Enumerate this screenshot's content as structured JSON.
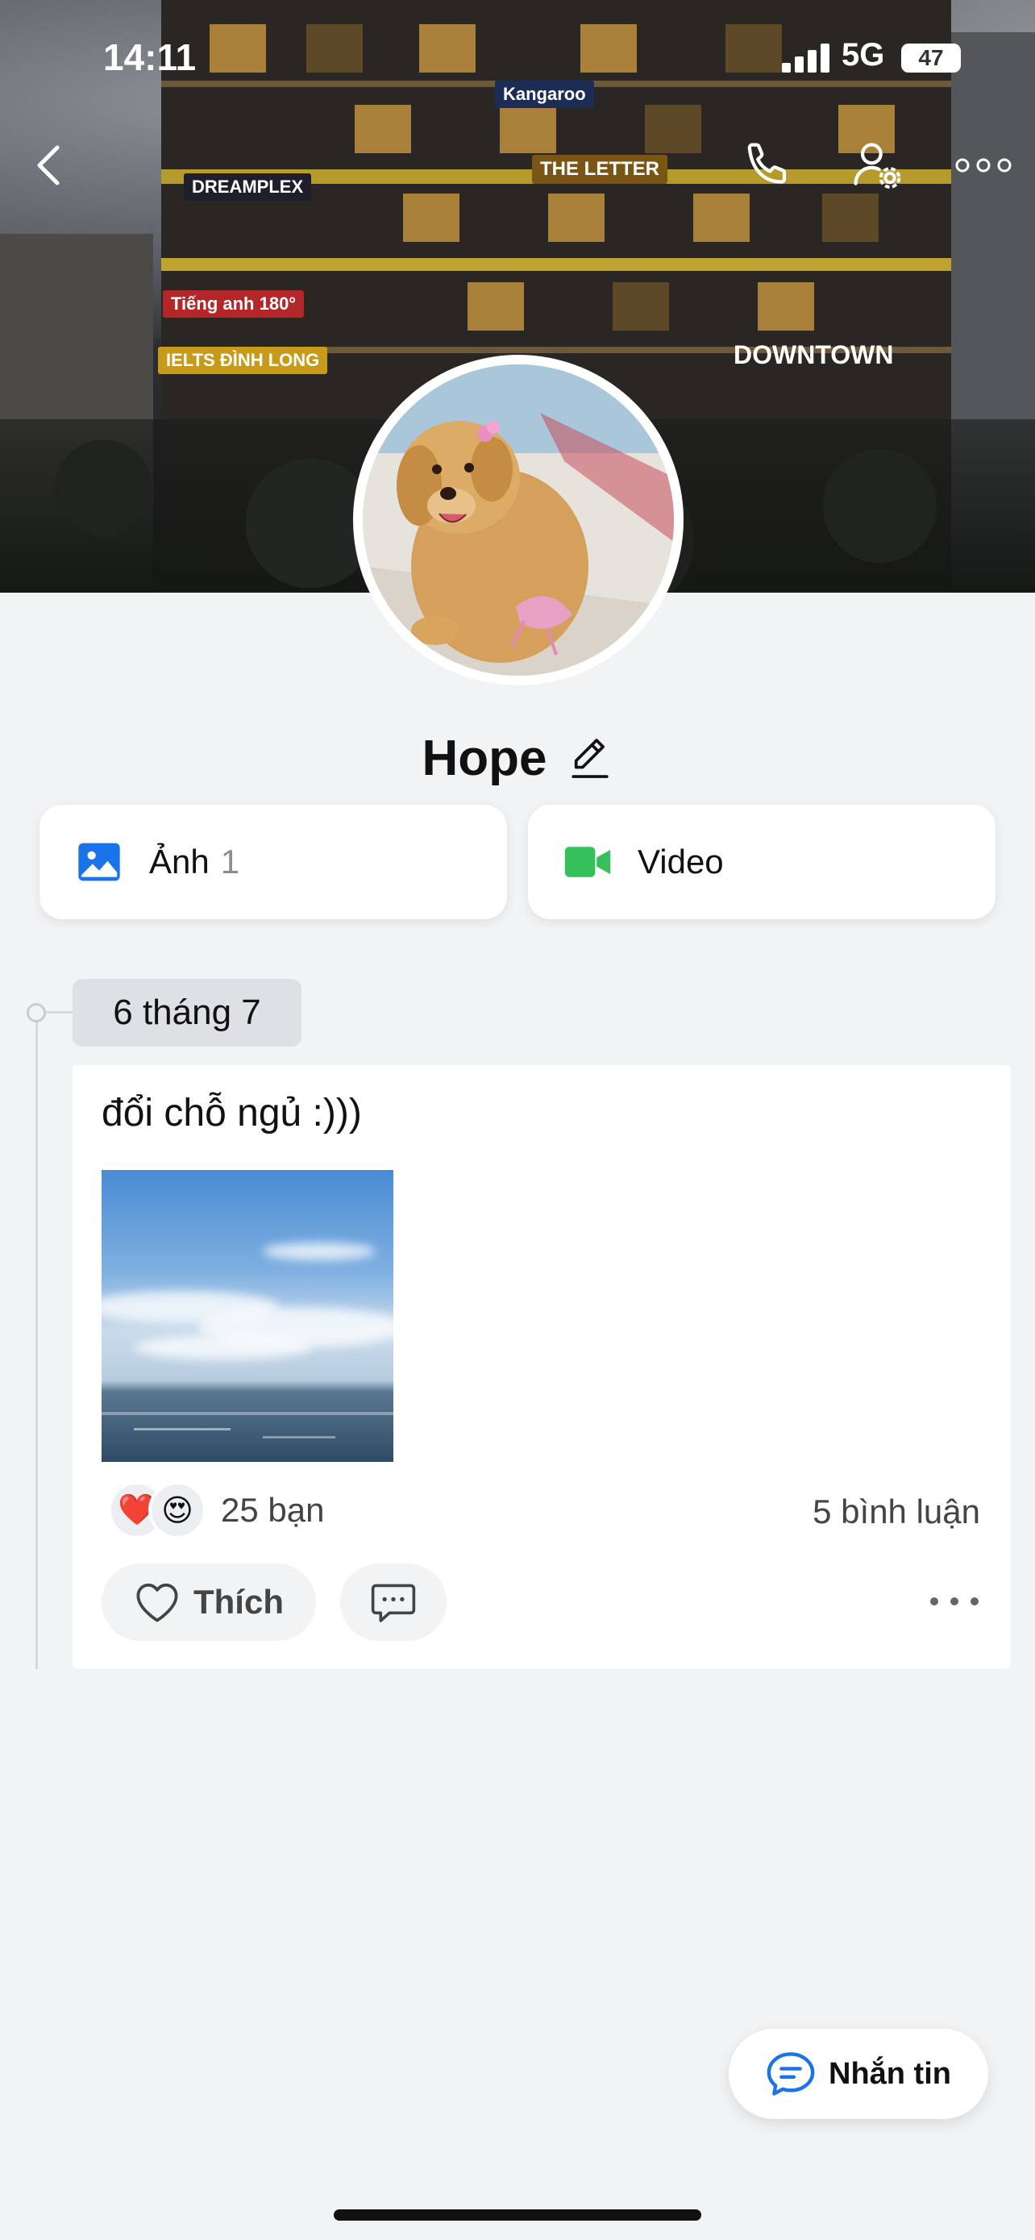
{
  "status_bar": {
    "time": "14:11",
    "network": "5G",
    "battery": "47"
  },
  "header": {
    "back_icon": "chevron-left-icon",
    "call_icon": "phone-icon",
    "settings_icon": "user-settings-icon",
    "more_icon": "more-horizontal-icon"
  },
  "profile": {
    "name": "Hope",
    "edit_icon": "pencil-icon"
  },
  "media": {
    "photos_label": "Ảnh",
    "photos_count": "1",
    "video_label": "Video",
    "photos_icon_color": "#1a73e8",
    "video_icon_color": "#34c15a"
  },
  "timeline": {
    "date": "6 tháng 7",
    "post": {
      "text": "đổi chỗ ngủ :)))",
      "reactions": [
        "❤️",
        "😍"
      ],
      "reaction_count": "25 bạn",
      "comments": "5 bình luận",
      "like_label": "Thích"
    }
  },
  "message_button": {
    "label": "Nhắn tin",
    "icon_color": "#1a73e8"
  }
}
